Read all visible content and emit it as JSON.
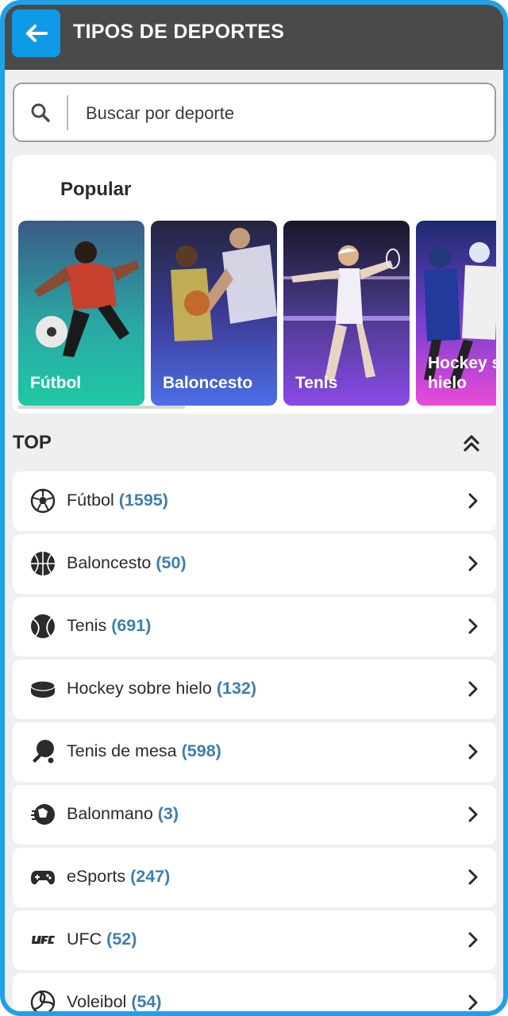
{
  "header": {
    "title": "TIPOS DE DEPORTES",
    "back_icon": "arrow-left-icon"
  },
  "search": {
    "placeholder": "Buscar por deporte",
    "icon": "search-icon"
  },
  "popular": {
    "title": "Popular",
    "cards": [
      {
        "label": "Fútbol",
        "colors": [
          "#3a5b86",
          "#22c9a8"
        ]
      },
      {
        "label": "Baloncesto",
        "colors": [
          "#2d2a55",
          "#4b6de6"
        ]
      },
      {
        "label": "Tenis",
        "colors": [
          "#1b1b35",
          "#8a4ae8"
        ]
      },
      {
        "label": "Hockey sobre hielo",
        "colors": [
          "#1b2b6e",
          "#e94ad6"
        ]
      }
    ]
  },
  "top": {
    "title": "TOP",
    "items": [
      {
        "name": "Fútbol",
        "count": "(1595)",
        "icon": "soccer-ball-icon"
      },
      {
        "name": "Baloncesto",
        "count": "(50)",
        "icon": "basketball-icon"
      },
      {
        "name": "Tenis",
        "count": "(691)",
        "icon": "tennis-ball-icon"
      },
      {
        "name": "Hockey sobre hielo",
        "count": "(132)",
        "icon": "hockey-puck-icon"
      },
      {
        "name": "Tenis de mesa",
        "count": "(598)",
        "icon": "ping-pong-icon"
      },
      {
        "name": "Balonmano",
        "count": "(3)",
        "icon": "handball-icon"
      },
      {
        "name": "eSports",
        "count": "(247)",
        "icon": "gamepad-icon"
      },
      {
        "name": "UFC",
        "count": "(52)",
        "icon": "ufc-icon"
      },
      {
        "name": "Voleibol",
        "count": "(54)",
        "icon": "volleyball-icon"
      }
    ]
  },
  "colors": {
    "accent": "#0e9ae6",
    "frame": "#1ea1e6",
    "header_bg": "#4a4a4a",
    "count": "#3e7fae"
  }
}
